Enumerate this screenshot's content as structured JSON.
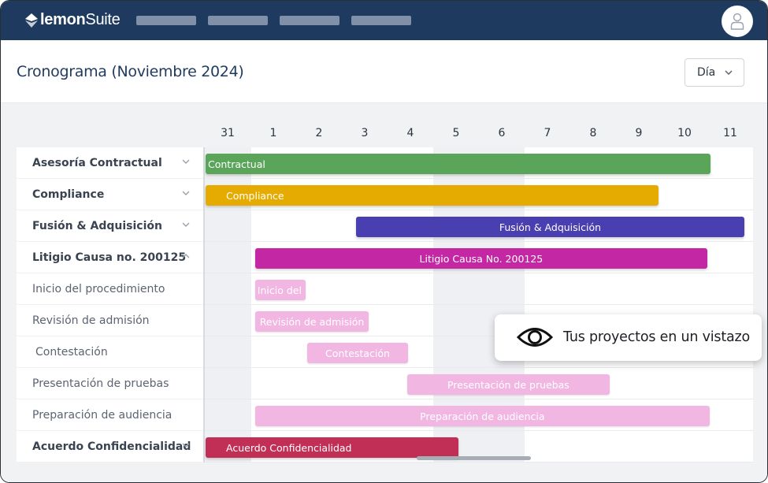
{
  "app": {
    "logo_bold": "lemon",
    "logo_light": "Suite",
    "nav_placeholders": 4
  },
  "header": {
    "title": "Cronograma (Noviembre 2024)",
    "view_select": {
      "selected": "Día"
    }
  },
  "timeline": {
    "days": [
      "31",
      "1",
      "2",
      "3",
      "4",
      "5",
      "6",
      "7",
      "8",
      "9",
      "10",
      "11"
    ],
    "weekend_day_indices": [
      0,
      5,
      6
    ]
  },
  "rows": [
    {
      "label": "Asesoría Contractual",
      "group": true,
      "expanded": false,
      "bar": {
        "label": "Contractual",
        "color": "#5aa55a",
        "start": 0,
        "end": 11.07,
        "align": "left"
      }
    },
    {
      "label": "Compliance",
      "group": true,
      "expanded": false,
      "bar": {
        "label": "Compliance",
        "color": "#e6ab00",
        "start": 0,
        "end": 9.93,
        "align": "left-pad"
      }
    },
    {
      "label": "Fusión & Adquisición",
      "group": true,
      "expanded": false,
      "bar": {
        "label": "Fusión & Adquisición",
        "color": "#4a3fb0",
        "start": 3.31,
        "end": 11.81,
        "align": "center"
      }
    },
    {
      "label": "Litigio Causa no. 200125",
      "group": true,
      "expanded": true,
      "bar": {
        "label": "Litigio Causa No. 200125",
        "color": "#c427a3",
        "start": 1.1,
        "end": 11.0,
        "align": "center"
      }
    },
    {
      "label": "Inicio del procedimiento",
      "group": false,
      "bar": {
        "label": "Inicio del p",
        "color": "#f2b6e3",
        "start": 1.1,
        "end": 2.21,
        "align": "left"
      }
    },
    {
      "label": "Revisión de admisión",
      "group": false,
      "bar": {
        "label": "Revisión de admisión",
        "color": "#f2b6e3",
        "start": 1.1,
        "end": 3.59,
        "align": "center"
      }
    },
    {
      "label": "Contestación",
      "group": false,
      "bar": {
        "label": "Contestación",
        "color": "#f2b6e3",
        "start": 2.24,
        "end": 4.45,
        "align": "center"
      }
    },
    {
      "label": "Presentación de pruebas",
      "group": false,
      "bar": {
        "label": "Presentación de pruebas",
        "color": "#f2b6e3",
        "start": 4.43,
        "end": 8.86,
        "align": "center"
      }
    },
    {
      "label": "Preparación de audiencia",
      "group": false,
      "bar": {
        "label": "Preparación de audiencia",
        "color": "#f2b6e3",
        "start": 1.1,
        "end": 11.05,
        "align": "center"
      }
    },
    {
      "label": "Acuerdo Confidencialidad",
      "group": true,
      "expanded": false,
      "bar": {
        "label": "Acuerdo Confidencialidad",
        "color": "#c12f57",
        "start": 0,
        "end": 5.55,
        "align": "left-pad"
      }
    }
  ],
  "tooltip": {
    "text": "Tus proyectos en un vistazo",
    "icon": "eye-icon"
  }
}
